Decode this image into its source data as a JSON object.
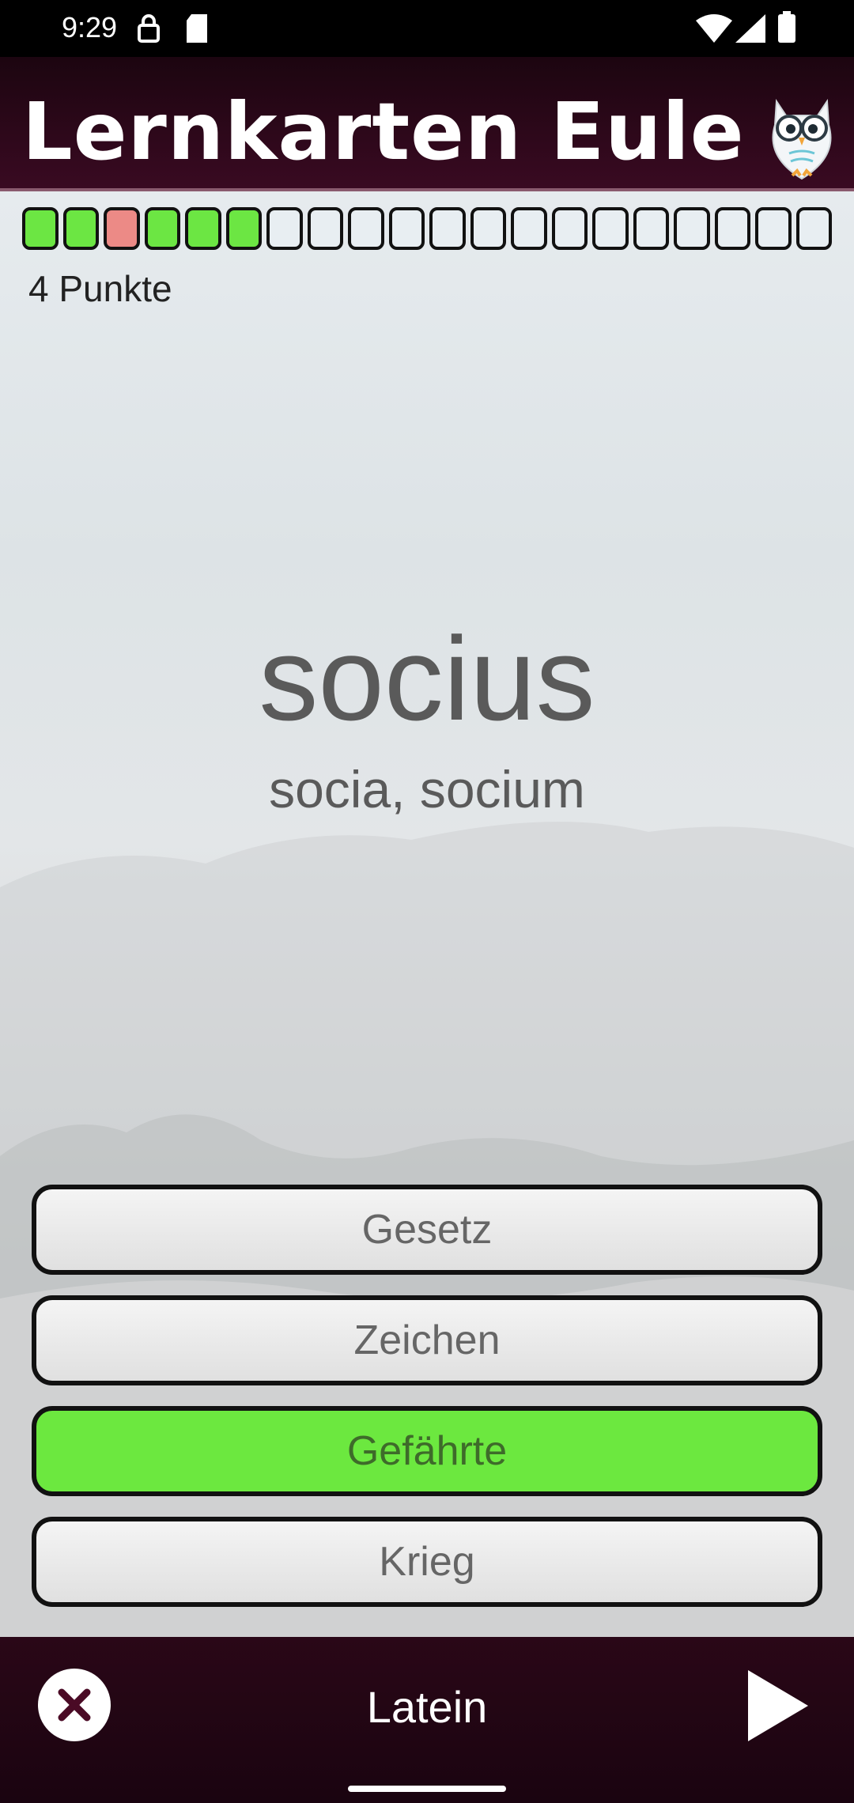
{
  "status_bar": {
    "time": "9:29",
    "icons": [
      "vpn-key-icon",
      "sd-card-icon",
      "wifi-icon",
      "signal-icon",
      "battery-icon"
    ]
  },
  "app_bar": {
    "title": "Lernkarten Eule",
    "logo_icon": "owl-icon"
  },
  "progress": {
    "segments": [
      "correct",
      "correct",
      "wrong",
      "correct",
      "correct",
      "correct",
      "empty",
      "empty",
      "empty",
      "empty",
      "empty",
      "empty",
      "empty",
      "empty",
      "empty",
      "empty",
      "empty",
      "empty",
      "empty",
      "empty"
    ],
    "points_label": "4 Punkte"
  },
  "card": {
    "word": "socius",
    "forms": "socia, socium"
  },
  "answers": [
    {
      "label": "Gesetz",
      "state": "default"
    },
    {
      "label": "Zeichen",
      "state": "default"
    },
    {
      "label": "Gefährte",
      "state": "correct"
    },
    {
      "label": "Krieg",
      "state": "default"
    }
  ],
  "bottom_bar": {
    "language": "Latein",
    "close_icon": "close-icon",
    "next_icon": "play-icon"
  },
  "colors": {
    "correct": "#6ce643",
    "wrong": "#ec8a86",
    "empty": "#e8eef2",
    "bar_dark": "#2a0717"
  }
}
